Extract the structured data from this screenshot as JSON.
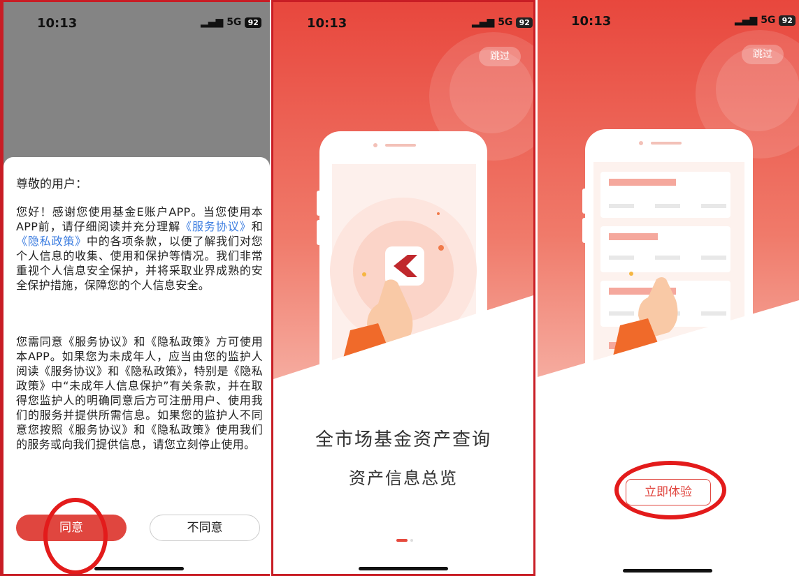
{
  "status": {
    "time": "10:13",
    "signal": "5G",
    "battery": "92"
  },
  "dialog": {
    "greeting": "尊敬的用户：",
    "p1_a": "您好！感谢您使用基金E账户APP。当您使用本APP前，请仔细阅读并充分理解",
    "link_service": "《服务协议》",
    "p1_b": "和",
    "link_privacy": "《隐私政策》",
    "p1_c": "中的各项条款，以便了解我们对您个人信息的收集、使用和保护等情况。我们非常重视个人信息安全保护，并将采取业界成熟的安全保护措施，保障您的个人信息安全。",
    "p2": "您需同意《服务协议》和《隐私政策》方可使用本APP。如果您为未成年人，应当由您的监护人阅读《服务协议》和《隐私政策》，特别是《隐私政策》中“未成年人信息保护”有关条款，并在取得您监护人的明确同意后方可注册用户、使用我们的服务并提供所需信息。如果您的监护人不同意您按照《服务协议》和《隐私政策》使用我们的服务或向我们提供信息，请您立刻停止使用。",
    "agree": "同意",
    "disagree": "不同意"
  },
  "onboard": {
    "skip": "跳过",
    "headline": "全市场基金资产查询",
    "subline": "资产信息总览",
    "try_now": "立即体验"
  },
  "colors": {
    "accent": "#e0463f",
    "annotation": "#e31b1b",
    "link": "#3c7de0"
  }
}
